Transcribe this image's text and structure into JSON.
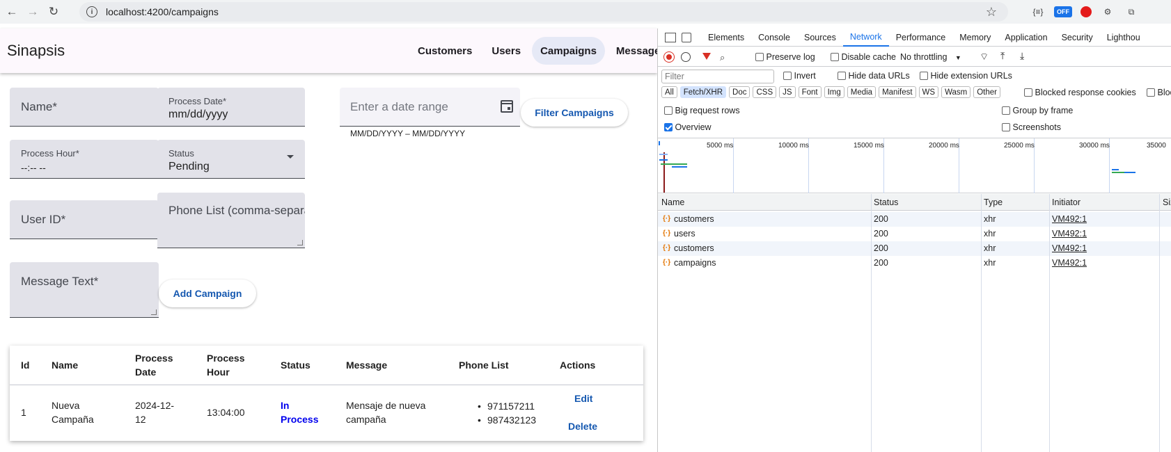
{
  "browser": {
    "url": "localhost:4200/campaigns",
    "ext_off_label": "OFF",
    "ext_json_label": "{≡}"
  },
  "app": {
    "brand": "Sinapsis",
    "nav": [
      {
        "label": "Customers",
        "active": false
      },
      {
        "label": "Users",
        "active": false
      },
      {
        "label": "Campaigns",
        "active": true
      },
      {
        "label": "Messages",
        "active": false
      }
    ],
    "form": {
      "name_placeholder": "Name*",
      "process_date_label": "Process Date*",
      "process_date_value": "mm/dd/yyyy",
      "process_hour_label": "Process Hour*",
      "process_hour_value": "--:-- --",
      "status_label": "Status",
      "status_value": "Pending",
      "user_id_placeholder": "User ID*",
      "phone_list_placeholder": "Phone List (comma-separa",
      "message_placeholder": "Message Text*",
      "add_button": "Add Campaign"
    },
    "filter": {
      "date_range_placeholder": "Enter a date range",
      "date_hint": "MM/DD/YYYY – MM/DD/YYYY",
      "filter_button": "Filter Campaigns"
    },
    "table": {
      "headers": [
        "Id",
        "Name",
        "Process Date",
        "Process Hour",
        "Status",
        "Message",
        "Phone List",
        "Actions"
      ],
      "header_lines": {
        "process_date": [
          "Process",
          "Date"
        ],
        "process_hour": [
          "Process",
          "Hour"
        ]
      },
      "rows": [
        {
          "id": "1",
          "name_lines": [
            "Nueva",
            "Campaña"
          ],
          "process_date_lines": [
            "2024-12-",
            "12"
          ],
          "process_hour": "13:04:00",
          "status_lines": [
            "In",
            "Process"
          ],
          "message_lines": [
            "Mensaje de nueva",
            "campaña"
          ],
          "phones": [
            "971157211",
            "987432123"
          ],
          "edit": "Edit",
          "delete": "Delete"
        }
      ]
    }
  },
  "devtools": {
    "tabs": [
      "Elements",
      "Console",
      "Sources",
      "Network",
      "Performance",
      "Memory",
      "Application",
      "Security",
      "Lighthou"
    ],
    "active_tab": "Network",
    "toolbar": {
      "preserve_log": "Preserve log",
      "disable_cache": "Disable cache",
      "throttling": "No throttling"
    },
    "filter_placeholder": "Filter",
    "invert": "Invert",
    "hide_data_urls": "Hide data URLs",
    "hide_extension_urls": "Hide extension URLs",
    "chips": [
      "All",
      "Fetch/XHR",
      "Doc",
      "CSS",
      "JS",
      "Font",
      "Img",
      "Media",
      "Manifest",
      "WS",
      "Wasm",
      "Other"
    ],
    "active_chip": "Fetch/XHR",
    "blocked_response_cookies": "Blocked response cookies",
    "blocked_tail": "Bloc",
    "big_request_rows": "Big request rows",
    "group_by_frame": "Group by frame",
    "overview": "Overview",
    "screenshots": "Screenshots",
    "timeline_ticks": [
      "5000 ms",
      "10000 ms",
      "15000 ms",
      "20000 ms",
      "25000 ms",
      "30000 ms",
      "35000"
    ],
    "columns": [
      "Name",
      "Status",
      "Type",
      "Initiator",
      "Siz"
    ],
    "requests": [
      {
        "name": "customers",
        "status": "200",
        "type": "xhr",
        "initiator": "VM492:1"
      },
      {
        "name": "users",
        "status": "200",
        "type": "xhr",
        "initiator": "VM492:1"
      },
      {
        "name": "customers",
        "status": "200",
        "type": "xhr",
        "initiator": "VM492:1"
      },
      {
        "name": "campaigns",
        "status": "200",
        "type": "xhr",
        "initiator": "VM492:1"
      }
    ],
    "colors": {
      "accent": "#1a73e8",
      "record": "#d93025"
    }
  }
}
